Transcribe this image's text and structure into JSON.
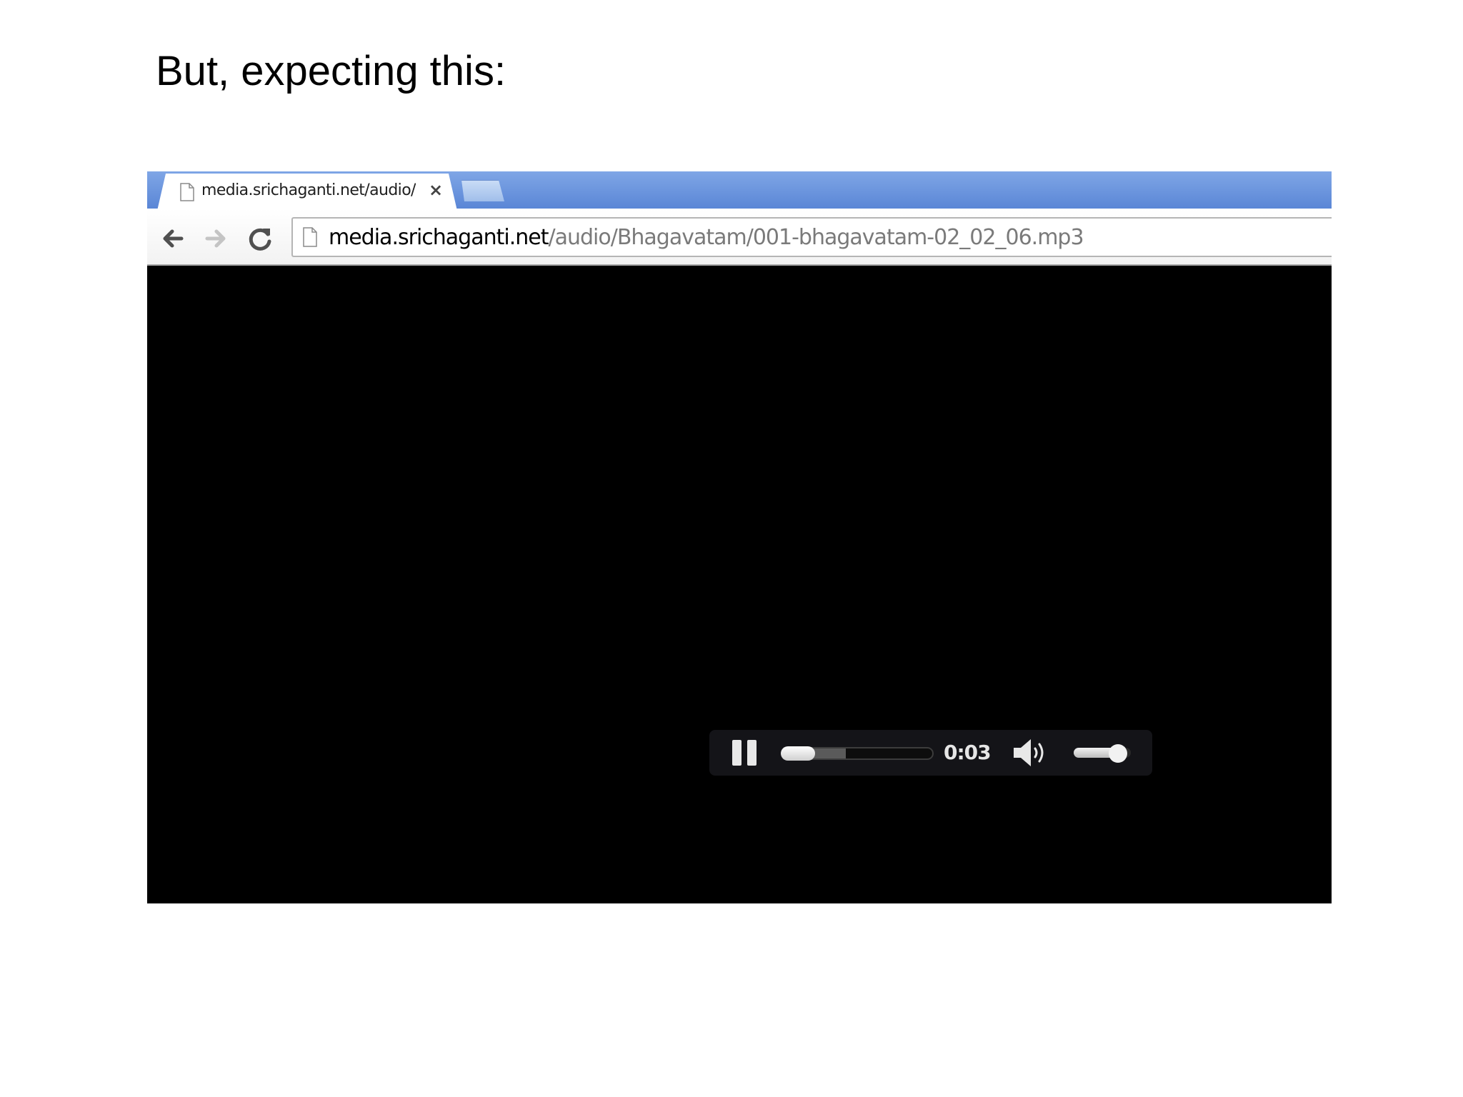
{
  "slide": {
    "title": "But, expecting this:"
  },
  "browser": {
    "tab": {
      "title": "media.srichaganti.net/audio/",
      "close_glyph": "×",
      "page_icon": "page-icon"
    },
    "new_tab_icon": "new-tab-icon",
    "toolbar": {
      "back_icon": "back-arrow-icon",
      "forward_icon": "forward-arrow-icon",
      "reload_icon": "reload-icon",
      "page_icon": "page-icon"
    },
    "omnibox": {
      "url_host": "media.srichaganti.net",
      "url_path": "/audio/Bhagavatam/001-bhagavatam-02_02_06.mp3"
    },
    "colors": {
      "tabstrip": "#5a86d6",
      "content_background": "#000000"
    }
  },
  "player": {
    "state_icon": "pause-icon",
    "time": "0:03",
    "seek_fraction": 0.0,
    "buffered_fraction": 0.42,
    "volume_icon": "speaker-icon",
    "volume_fraction": 0.78
  }
}
